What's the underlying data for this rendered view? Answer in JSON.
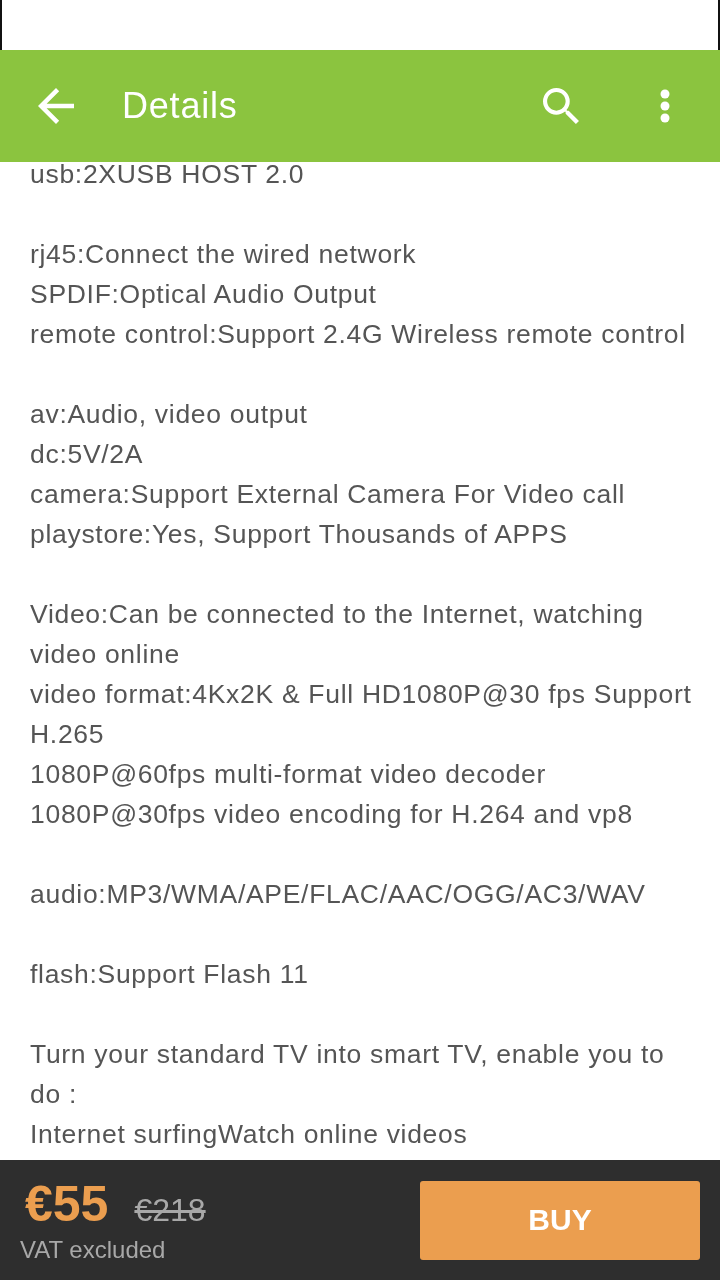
{
  "toolbar": {
    "title": "Details"
  },
  "description": {
    "groups": [
      {
        "lines": [
          "usb:2XUSB HOST 2.0"
        ]
      },
      {
        "lines": [
          "rj45:Connect the wired network",
          "SPDIF:Optical Audio Output",
          "remote control:Support 2.4G Wireless remote control"
        ]
      },
      {
        "lines": [
          "av:Audio, video output",
          "dc:5V/2A",
          "camera:Support External Camera For Video call",
          "playstore:Yes, Support Thousands of APPS"
        ]
      },
      {
        "lines": [
          "Video:Can be connected to the Internet, watching video online",
          "video format:4Kx2K & Full HD1080P@30 fps Support H.265",
          "1080P@60fps multi-format video decoder",
          "1080P@30fps video encoding for H.264 and vp8"
        ]
      },
      {
        "lines": [
          "audio:MP3/WMA/APE/FLAC/AAC/OGG/AC3/WAV"
        ]
      },
      {
        "lines": [
          "flash:Support Flash 11"
        ]
      },
      {
        "lines": [
          "Turn your standard TV into smart TV, enable you to do :",
          "Internet surfingWatch online videos"
        ]
      }
    ]
  },
  "price_bar": {
    "price": "€55",
    "old_price": "€218",
    "note": "VAT excluded",
    "buy_button": "BUY"
  }
}
